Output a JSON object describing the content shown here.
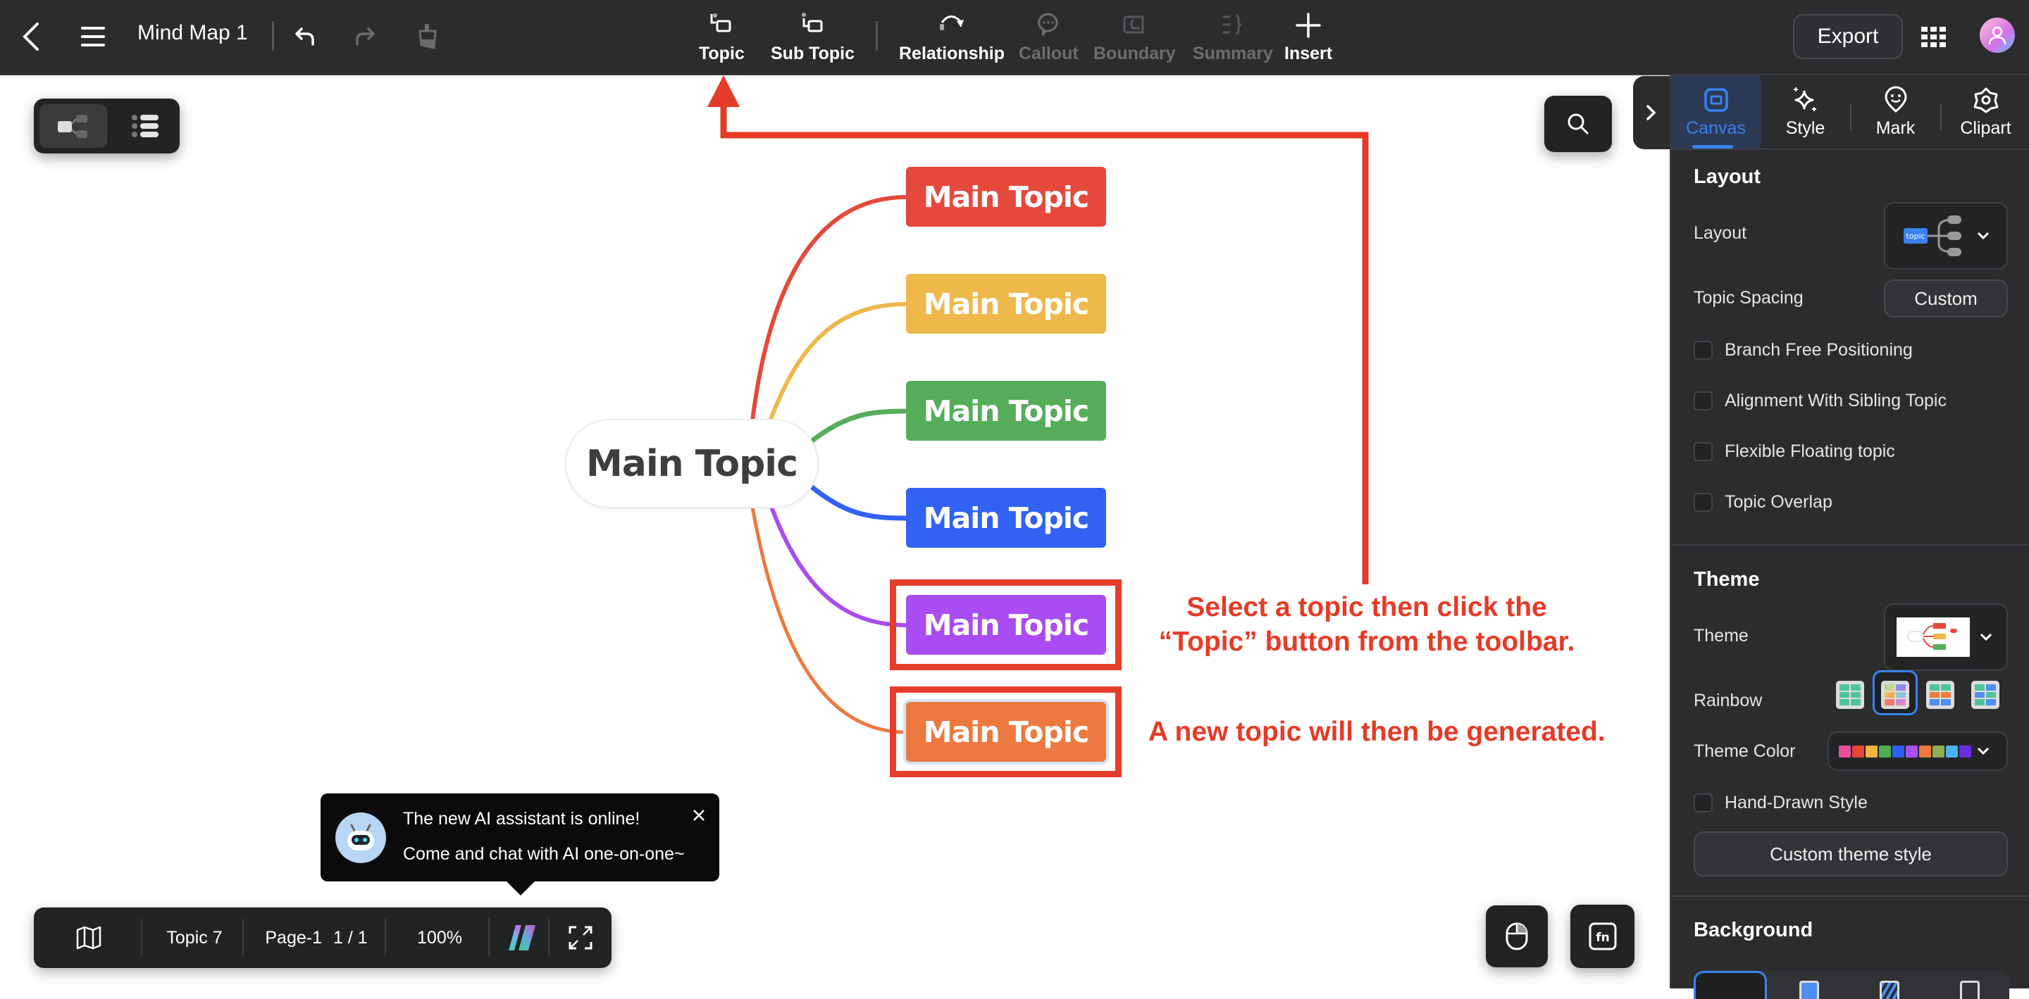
{
  "header": {
    "title": "Mind Map 1",
    "tools": [
      {
        "label": "Topic",
        "icon": "topic-icon",
        "enabled": true
      },
      {
        "label": "Sub Topic",
        "icon": "subtopic-icon",
        "enabled": true
      },
      {
        "label": "Relationship",
        "icon": "relationship-icon",
        "enabled": true
      },
      {
        "label": "Callout",
        "icon": "callout-icon",
        "enabled": false
      },
      {
        "label": "Boundary",
        "icon": "boundary-icon",
        "enabled": false
      },
      {
        "label": "Summary",
        "icon": "summary-icon",
        "enabled": false
      },
      {
        "label": "Insert",
        "icon": "plus-icon",
        "enabled": true
      }
    ],
    "export_label": "Export"
  },
  "panel": {
    "tabs": [
      {
        "label": "Canvas",
        "active": true
      },
      {
        "label": "Style",
        "active": false
      },
      {
        "label": "Mark",
        "active": false
      },
      {
        "label": "Clipart",
        "active": false
      }
    ],
    "layout_section": {
      "title": "Layout",
      "layout_label": "Layout",
      "layout_preview_text": "topic",
      "topic_spacing_label": "Topic Spacing",
      "topic_spacing_value": "Custom",
      "checkboxes": [
        {
          "label": "Branch Free Positioning",
          "checked": false
        },
        {
          "label": "Alignment With Sibling Topic",
          "checked": false
        },
        {
          "label": "Flexible Floating topic",
          "checked": false
        },
        {
          "label": "Topic Overlap",
          "checked": false
        }
      ]
    },
    "theme_section": {
      "title": "Theme",
      "theme_label": "Theme",
      "rainbow_label": "Rainbow",
      "rainbow_selected_index": 1,
      "theme_color_label": "Theme Color",
      "theme_colors": [
        "#e84f9a",
        "#e5483b",
        "#f0b73e",
        "#4cae55",
        "#2f5ff2",
        "#a94ff3",
        "#ef7a3a",
        "#8db152",
        "#4eb2f5",
        "#6a2ee0"
      ],
      "hand_drawn_label": "Hand-Drawn Style",
      "hand_drawn_checked": false,
      "custom_theme_label": "Custom theme style"
    },
    "background_section": {
      "title": "Background"
    }
  },
  "mindmap": {
    "central": "Main Topic",
    "topics": [
      {
        "label": "Main Topic",
        "color": "#e5493b"
      },
      {
        "label": "Main Topic",
        "color": "#efb84a"
      },
      {
        "label": "Main Topic",
        "color": "#55ad5a"
      },
      {
        "label": "Main Topic",
        "color": "#3262f4"
      },
      {
        "label": "Main Topic",
        "color": "#a94df2"
      },
      {
        "label": "Main Topic",
        "color": "#ec7a40"
      }
    ]
  },
  "annotations": {
    "line1": "Select a topic then click the",
    "line2": "“Topic” button from the toolbar.",
    "line3": "A new topic will then be generated.",
    "color": "#e63b26"
  },
  "ai_popup": {
    "line1": "The new AI assistant is online!",
    "line2": "Come and chat with AI one-on-one~"
  },
  "bottom_bar": {
    "topic_count": "Topic 7",
    "page_name": "Page-1",
    "page_index": "1 / 1",
    "zoom": "100%"
  }
}
